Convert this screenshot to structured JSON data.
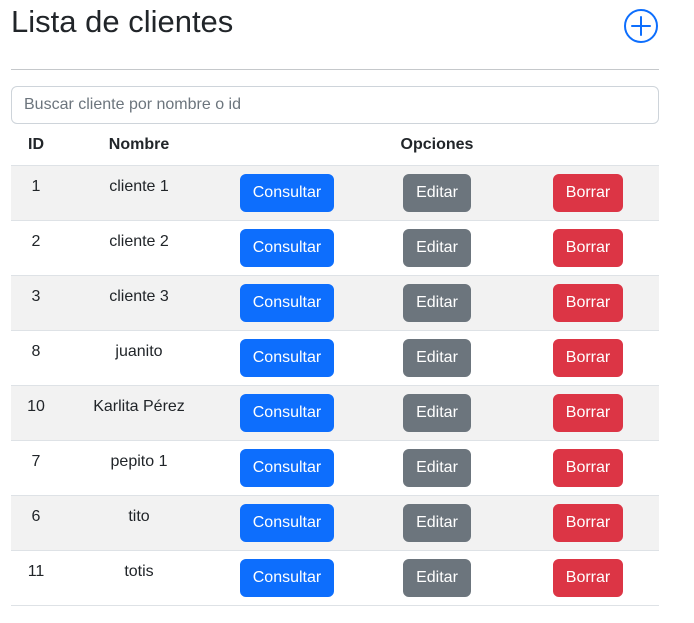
{
  "header": {
    "title": "Lista de clientes"
  },
  "search": {
    "placeholder": "Buscar cliente por nombre o id",
    "value": ""
  },
  "table": {
    "columns": {
      "id": "ID",
      "nombre": "Nombre",
      "opciones": "Opciones"
    },
    "rows": [
      {
        "id": "1",
        "nombre": "cliente 1"
      },
      {
        "id": "2",
        "nombre": "cliente 2"
      },
      {
        "id": "3",
        "nombre": "cliente 3"
      },
      {
        "id": "8",
        "nombre": "juanito"
      },
      {
        "id": "10",
        "nombre": "Karlita Pérez"
      },
      {
        "id": "7",
        "nombre": "pepito 1"
      },
      {
        "id": "6",
        "nombre": "tito"
      },
      {
        "id": "11",
        "nombre": "totis"
      }
    ],
    "actions": {
      "consultar": "Consultar",
      "editar": "Editar",
      "borrar": "Borrar"
    }
  },
  "icons": {
    "add": "plus-circle-icon"
  },
  "colors": {
    "primary": "#0d6efd",
    "secondary": "#6c757d",
    "danger": "#dc3545",
    "striped_row": "#f2f2f2"
  }
}
